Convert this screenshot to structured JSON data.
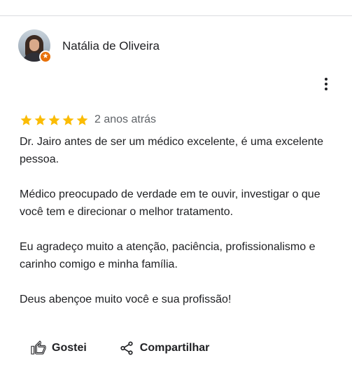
{
  "review": {
    "reviewer_name": "Natália de Oliveira",
    "rating": 5,
    "rating_max": 5,
    "date": "2 anos atrás",
    "paragraphs": [
      "Dr. Jairo antes de ser um médico excelente, é uma excelente pessoa.",
      "Médico preocupado de verdade em te ouvir, investigar o que você tem e direcionar o melhor tratamento.",
      "Eu agradeço muito a atenção, paciência, profissionalismo e carinho comigo e minha família.",
      "Deus abençoe muito você e sua profissão!"
    ]
  },
  "actions": {
    "like_label": "Gostei",
    "share_label": "Compartilhar"
  },
  "icons": {
    "star": "star-icon",
    "more": "more-vert-icon",
    "like": "thumb-up-icon",
    "share": "share-icon",
    "badge": "local-guide-badge-icon"
  },
  "colors": {
    "star": "#fbbc04",
    "badge": "#e8710a",
    "text": "#202124",
    "secondary_text": "#5f6368",
    "divider": "#dadce0"
  }
}
